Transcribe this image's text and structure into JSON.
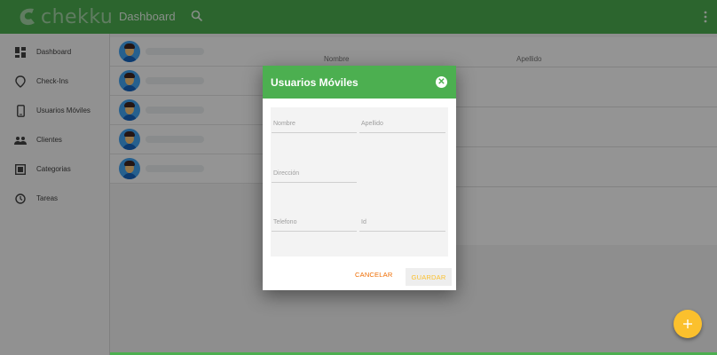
{
  "app": {
    "logo_text": "chekku",
    "page_title": "Dashboard"
  },
  "colors": {
    "primary": "#4caf50",
    "accent": "#fbc02d",
    "cancel": "#ef6c00"
  },
  "sidebar": {
    "items": [
      {
        "label": "Dashboard",
        "icon": "dashboard-icon"
      },
      {
        "label": "Check-Ins",
        "icon": "location-pin-icon"
      },
      {
        "label": "Usuarios Móviles",
        "icon": "phone-icon"
      },
      {
        "label": "Clientes",
        "icon": "people-icon"
      },
      {
        "label": "Categorias",
        "icon": "category-icon"
      },
      {
        "label": "Tareas",
        "icon": "clock-icon"
      }
    ]
  },
  "list": {
    "row_count": 5
  },
  "detail": {
    "columns": [
      "Nombre",
      "Apellido"
    ]
  },
  "dialog": {
    "title": "Usuarios Móviles",
    "fields": {
      "nombre": {
        "label": "Nombre",
        "value": ""
      },
      "apellido": {
        "label": "Apellido",
        "value": ""
      },
      "direccion": {
        "label": "Dirección",
        "value": ""
      },
      "telefono": {
        "label": "Telefono",
        "value": ""
      },
      "id": {
        "label": "Id",
        "value": ""
      }
    },
    "cancel_label": "CANCELAR",
    "save_label": "GUARDAR"
  },
  "fab": {
    "icon": "plus-icon"
  }
}
